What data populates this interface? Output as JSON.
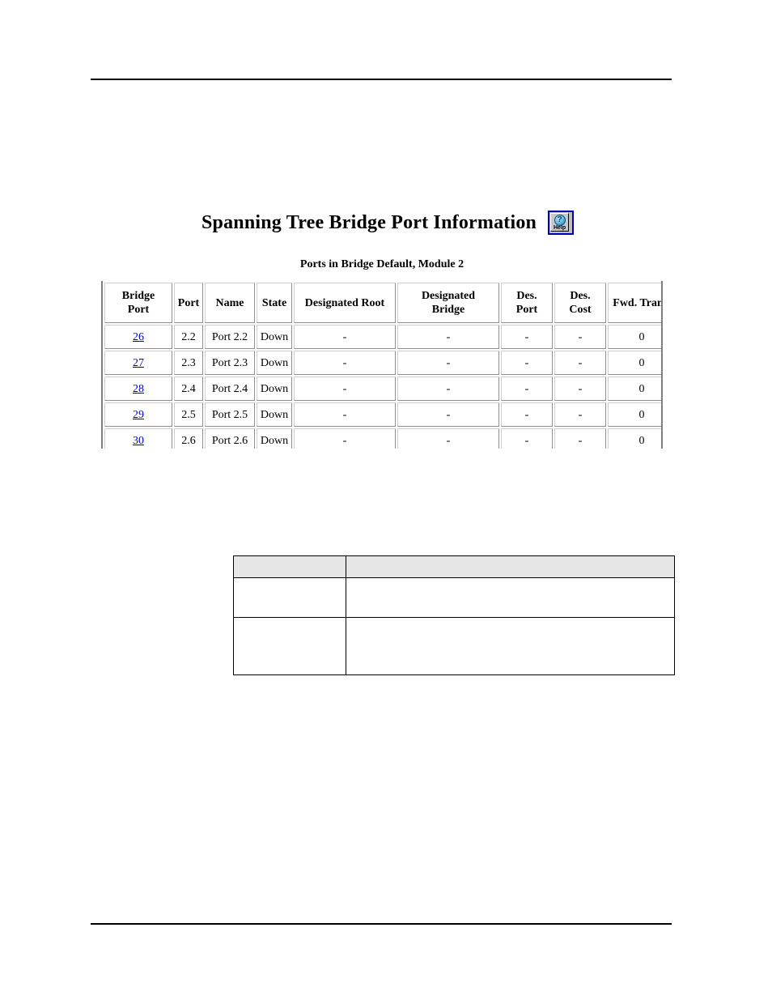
{
  "page": {
    "has_header_rule": true,
    "has_footer_rule": true
  },
  "screen": {
    "title": "Spanning Tree Bridge Port Information",
    "help_button": {
      "name": "help-button",
      "label": "Help",
      "glyph": "?",
      "border_color": "#0000b4",
      "face_color": "#c8c8cf"
    },
    "table_caption": "Ports in Bridge Default, Module 2",
    "link_color": "#0000c8",
    "table": {
      "columns": [
        "Bridge Port",
        "Port",
        "Name",
        "State",
        "Designated Root",
        "Designated Bridge",
        "Des. Port",
        "Des. Cost",
        "Fwd. Trans."
      ],
      "column_lines": [
        [
          "Bridge",
          "Port"
        ],
        [
          "Port"
        ],
        [
          "Name"
        ],
        [
          "State"
        ],
        [
          "Designated Root"
        ],
        [
          "Designated",
          "Bridge"
        ],
        [
          "Des.",
          "Port"
        ],
        [
          "Des.",
          "Cost"
        ],
        [
          "Fwd. Trans."
        ]
      ],
      "rows": [
        {
          "bridge_port": "26",
          "port": "2.2",
          "name": "Port 2.2",
          "state": "Down",
          "designated_root": "-",
          "designated_bridge": "-",
          "des_port": "-",
          "des_cost": "-",
          "fwd_trans": "0"
        },
        {
          "bridge_port": "27",
          "port": "2.3",
          "name": "Port 2.3",
          "state": "Down",
          "designated_root": "-",
          "designated_bridge": "-",
          "des_port": "-",
          "des_cost": "-",
          "fwd_trans": "0"
        },
        {
          "bridge_port": "28",
          "port": "2.4",
          "name": "Port 2.4",
          "state": "Down",
          "designated_root": "-",
          "designated_bridge": "-",
          "des_port": "-",
          "des_cost": "-",
          "fwd_trans": "0"
        },
        {
          "bridge_port": "29",
          "port": "2.5",
          "name": "Port 2.5",
          "state": "Down",
          "designated_root": "-",
          "designated_bridge": "-",
          "des_port": "-",
          "des_cost": "-",
          "fwd_trans": "0"
        },
        {
          "bridge_port": "30",
          "port": "2.6",
          "name": "Port 2.6",
          "state": "Down",
          "designated_root": "-",
          "designated_bridge": "-",
          "des_port": "-",
          "des_cost": "-",
          "fwd_trans": "0"
        }
      ]
    }
  },
  "description_table": {
    "header_background": "#e6e6e6",
    "header_cells": [
      "",
      ""
    ],
    "rows": [
      [
        "",
        ""
      ],
      [
        "",
        ""
      ]
    ]
  }
}
